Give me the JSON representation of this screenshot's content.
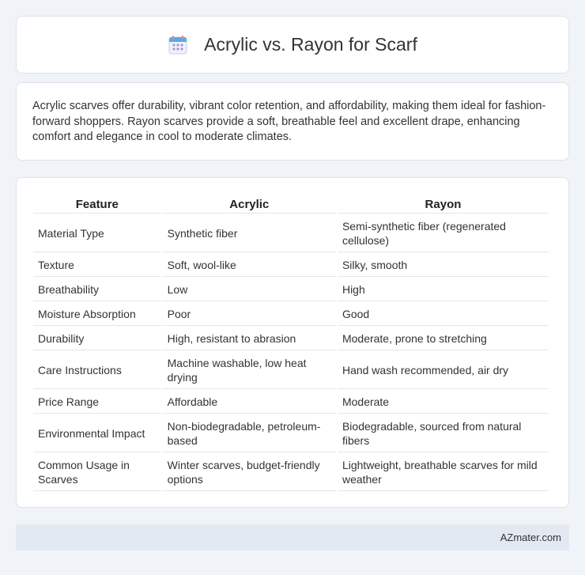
{
  "header": {
    "title": "Acrylic vs. Rayon for Scarf",
    "icon": "calendar-icon"
  },
  "intro": {
    "text": "Acrylic scarves offer durability, vibrant color retention, and affordability, making them ideal for fashion-forward shoppers. Rayon scarves provide a soft, breathable feel and excellent drape, enhancing comfort and elegance in cool to moderate climates."
  },
  "table": {
    "headers": [
      "Feature",
      "Acrylic",
      "Rayon"
    ],
    "rows": [
      [
        "Material Type",
        "Synthetic fiber",
        "Semi-synthetic fiber (regenerated cellulose)"
      ],
      [
        "Texture",
        "Soft, wool-like",
        "Silky, smooth"
      ],
      [
        "Breathability",
        "Low",
        "High"
      ],
      [
        "Moisture Absorption",
        "Poor",
        "Good"
      ],
      [
        "Durability",
        "High, resistant to abrasion",
        "Moderate, prone to stretching"
      ],
      [
        "Care Instructions",
        "Machine washable, low heat drying",
        "Hand wash recommended, air dry"
      ],
      [
        "Price Range",
        "Affordable",
        "Moderate"
      ],
      [
        "Environmental Impact",
        "Non-biodegradable, petroleum-based",
        "Biodegradable, sourced from natural fibers"
      ],
      [
        "Common Usage in Scarves",
        "Winter scarves, budget-friendly options",
        "Lightweight, breathable scarves for mild weather"
      ]
    ]
  },
  "footer": {
    "brand": "AZmater.com"
  },
  "colors": {
    "background": "#f0f3f8",
    "card": "#ffffff",
    "footer": "#e3e9f2",
    "icon_accent": "#7b6fd6"
  }
}
